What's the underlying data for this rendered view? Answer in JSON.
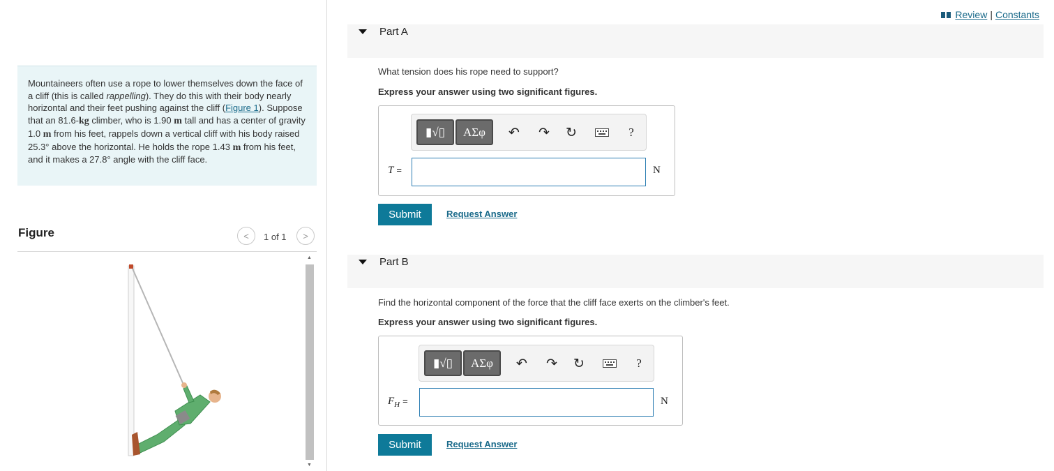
{
  "links": {
    "review": "Review",
    "separator": "|",
    "constants": "Constants"
  },
  "problem": {
    "t1": "Mountaineers often use a rope to lower themselves down the face of a cliff (this is called ",
    "t2": "rappelling",
    "t3": "). They do this with their body nearly horizontal and their feet pushing against the cliff (",
    "figure_link": "Figure 1",
    "t4": "). Suppose that an 81.6-",
    "u_kg": "kg",
    "t5": " climber, who is 1.90 ",
    "u_m1": "m",
    "t6": " tall and has a center of gravity 1.0 ",
    "u_m2": "m",
    "t7": " from his feet, rappels down a vertical cliff with his body raised 25.3° above the horizontal. He holds the rope 1.43 ",
    "u_m3": "m",
    "t8": " from his feet, and it makes a 27.8° angle with the cliff face."
  },
  "figure": {
    "title": "Figure",
    "counter": "1 of 1",
    "prev": "<",
    "next": ">"
  },
  "parts": [
    {
      "title": "Part A",
      "question": "What tension does his rope need to support?",
      "instruction": "Express your answer using two significant figures.",
      "variable": "T",
      "equals": "=",
      "value": "",
      "unit": "N",
      "submit": "Submit",
      "request": "Request Answer"
    },
    {
      "title": "Part B",
      "question": "Find the horizontal component of the force that the cliff face exerts on the climber's feet.",
      "instruction": "Express your answer using two significant figures.",
      "variable": "F",
      "subscript": "H",
      "equals": "=",
      "value": "",
      "unit": "N",
      "submit": "Submit",
      "request": "Request Answer"
    }
  ],
  "toolbar": {
    "templates": "▮√▯",
    "symbols": "ΑΣφ",
    "help": "?",
    "icons": [
      "templates-icon",
      "greek-symbols-icon",
      "undo-icon",
      "redo-icon",
      "reset-icon",
      "keyboard-icon",
      "help-icon"
    ]
  },
  "colors": {
    "accent": "#0e7a99",
    "link": "#1a6a8a",
    "problem_bg": "#e9f5f7",
    "climber": "#5fae6e"
  }
}
